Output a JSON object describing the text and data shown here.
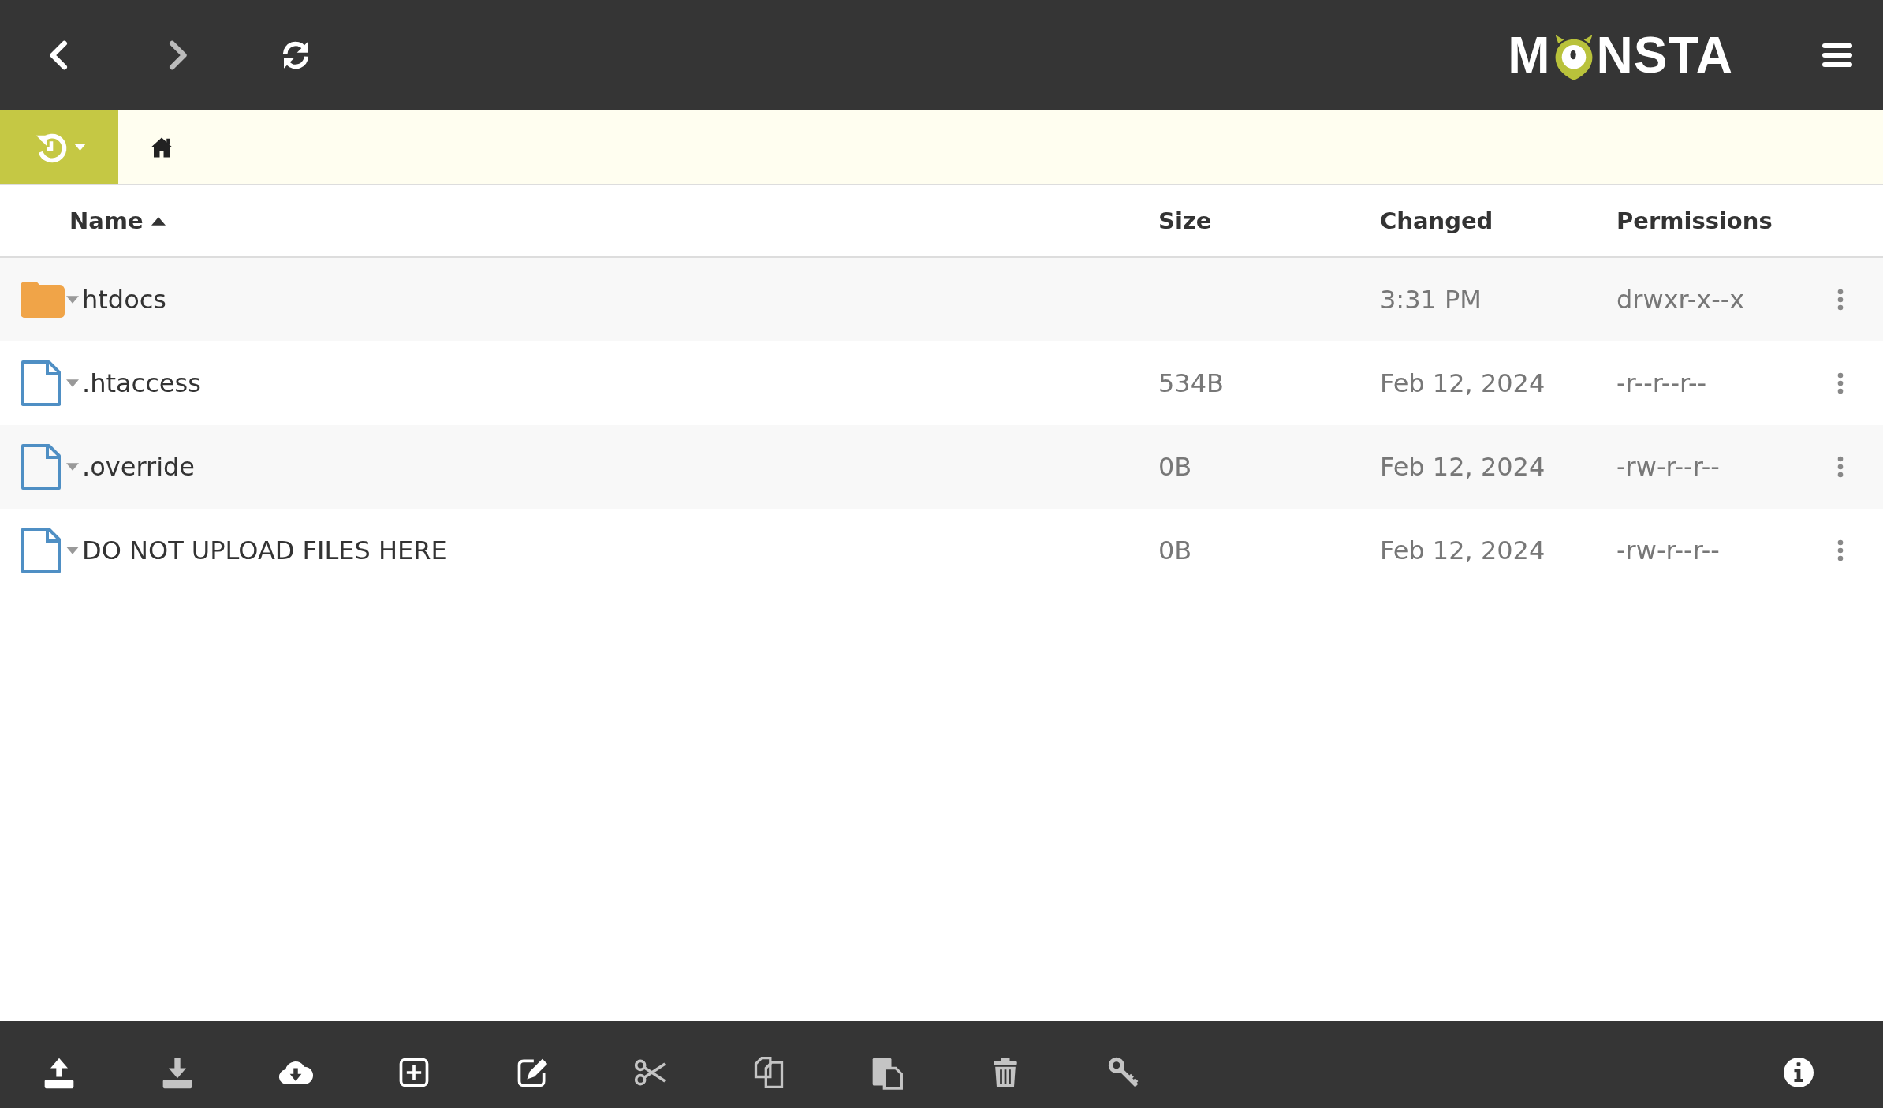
{
  "nav": [
    {
      "kind": "back",
      "disabled": false
    },
    {
      "kind": "forward",
      "disabled": true
    },
    {
      "kind": "refresh",
      "disabled": false
    }
  ],
  "logo": {
    "before": "M",
    "after": "NSTA"
  },
  "columns": [
    {
      "label": "Name",
      "sorted": true
    },
    {
      "label": "Size",
      "sorted": false
    },
    {
      "label": "Changed",
      "sorted": false
    },
    {
      "label": "Permissions",
      "sorted": false
    }
  ],
  "rows": [
    {
      "kind": "folder",
      "name": "htdocs",
      "size": "",
      "changed": "3:31 PM",
      "permissions": "drwxr-x--x"
    },
    {
      "kind": "file",
      "name": ".htaccess",
      "size": "534B",
      "changed": "Feb 12, 2024",
      "permissions": "-r--r--r--"
    },
    {
      "kind": "file",
      "name": ".override",
      "size": "0B",
      "changed": "Feb 12, 2024",
      "permissions": "-rw-r--r--"
    },
    {
      "kind": "file",
      "name": "DO NOT UPLOAD FILES HERE",
      "size": "0B",
      "changed": "Feb 12, 2024",
      "permissions": "-rw-r--r--"
    }
  ],
  "toolbar": [
    {
      "kind": "upload",
      "disabled": false
    },
    {
      "kind": "download",
      "disabled": true
    },
    {
      "kind": "cloud",
      "disabled": false
    },
    {
      "kind": "new",
      "disabled": false
    },
    {
      "kind": "edit",
      "disabled": false
    },
    {
      "kind": "cut",
      "disabled": true
    },
    {
      "kind": "copy",
      "disabled": true
    },
    {
      "kind": "paste",
      "disabled": true
    },
    {
      "kind": "delete",
      "disabled": true
    },
    {
      "kind": "key",
      "disabled": true
    }
  ]
}
